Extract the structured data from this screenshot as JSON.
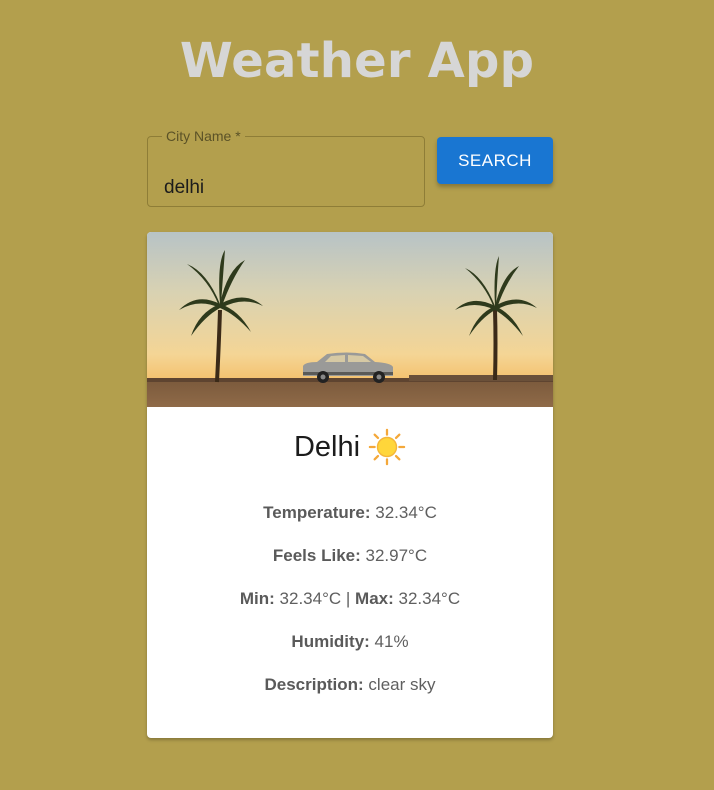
{
  "app": {
    "title": "Weather App"
  },
  "search": {
    "label": "City Name *",
    "value": "delhi",
    "button_label": "SEARCH"
  },
  "card": {
    "city": "Delhi",
    "weather_icon": "sun-icon",
    "temperature_label": "Temperature:",
    "temperature_value": " 32.34°C",
    "feels_like_label": "Feels Like:",
    "feels_like_value": " 32.97°C",
    "min_label": "Min:",
    "min_value": " 32.34°C | ",
    "max_label": "Max:",
    "max_value": " 32.34°C",
    "humidity_label": "Humidity:",
    "humidity_value": " 41%",
    "description_label": "Description:",
    "description_value": " clear sky"
  },
  "colors": {
    "background": "#b39f4d",
    "title": "#d6d6d6",
    "button": "#1976d2",
    "card": "#ffffff"
  }
}
